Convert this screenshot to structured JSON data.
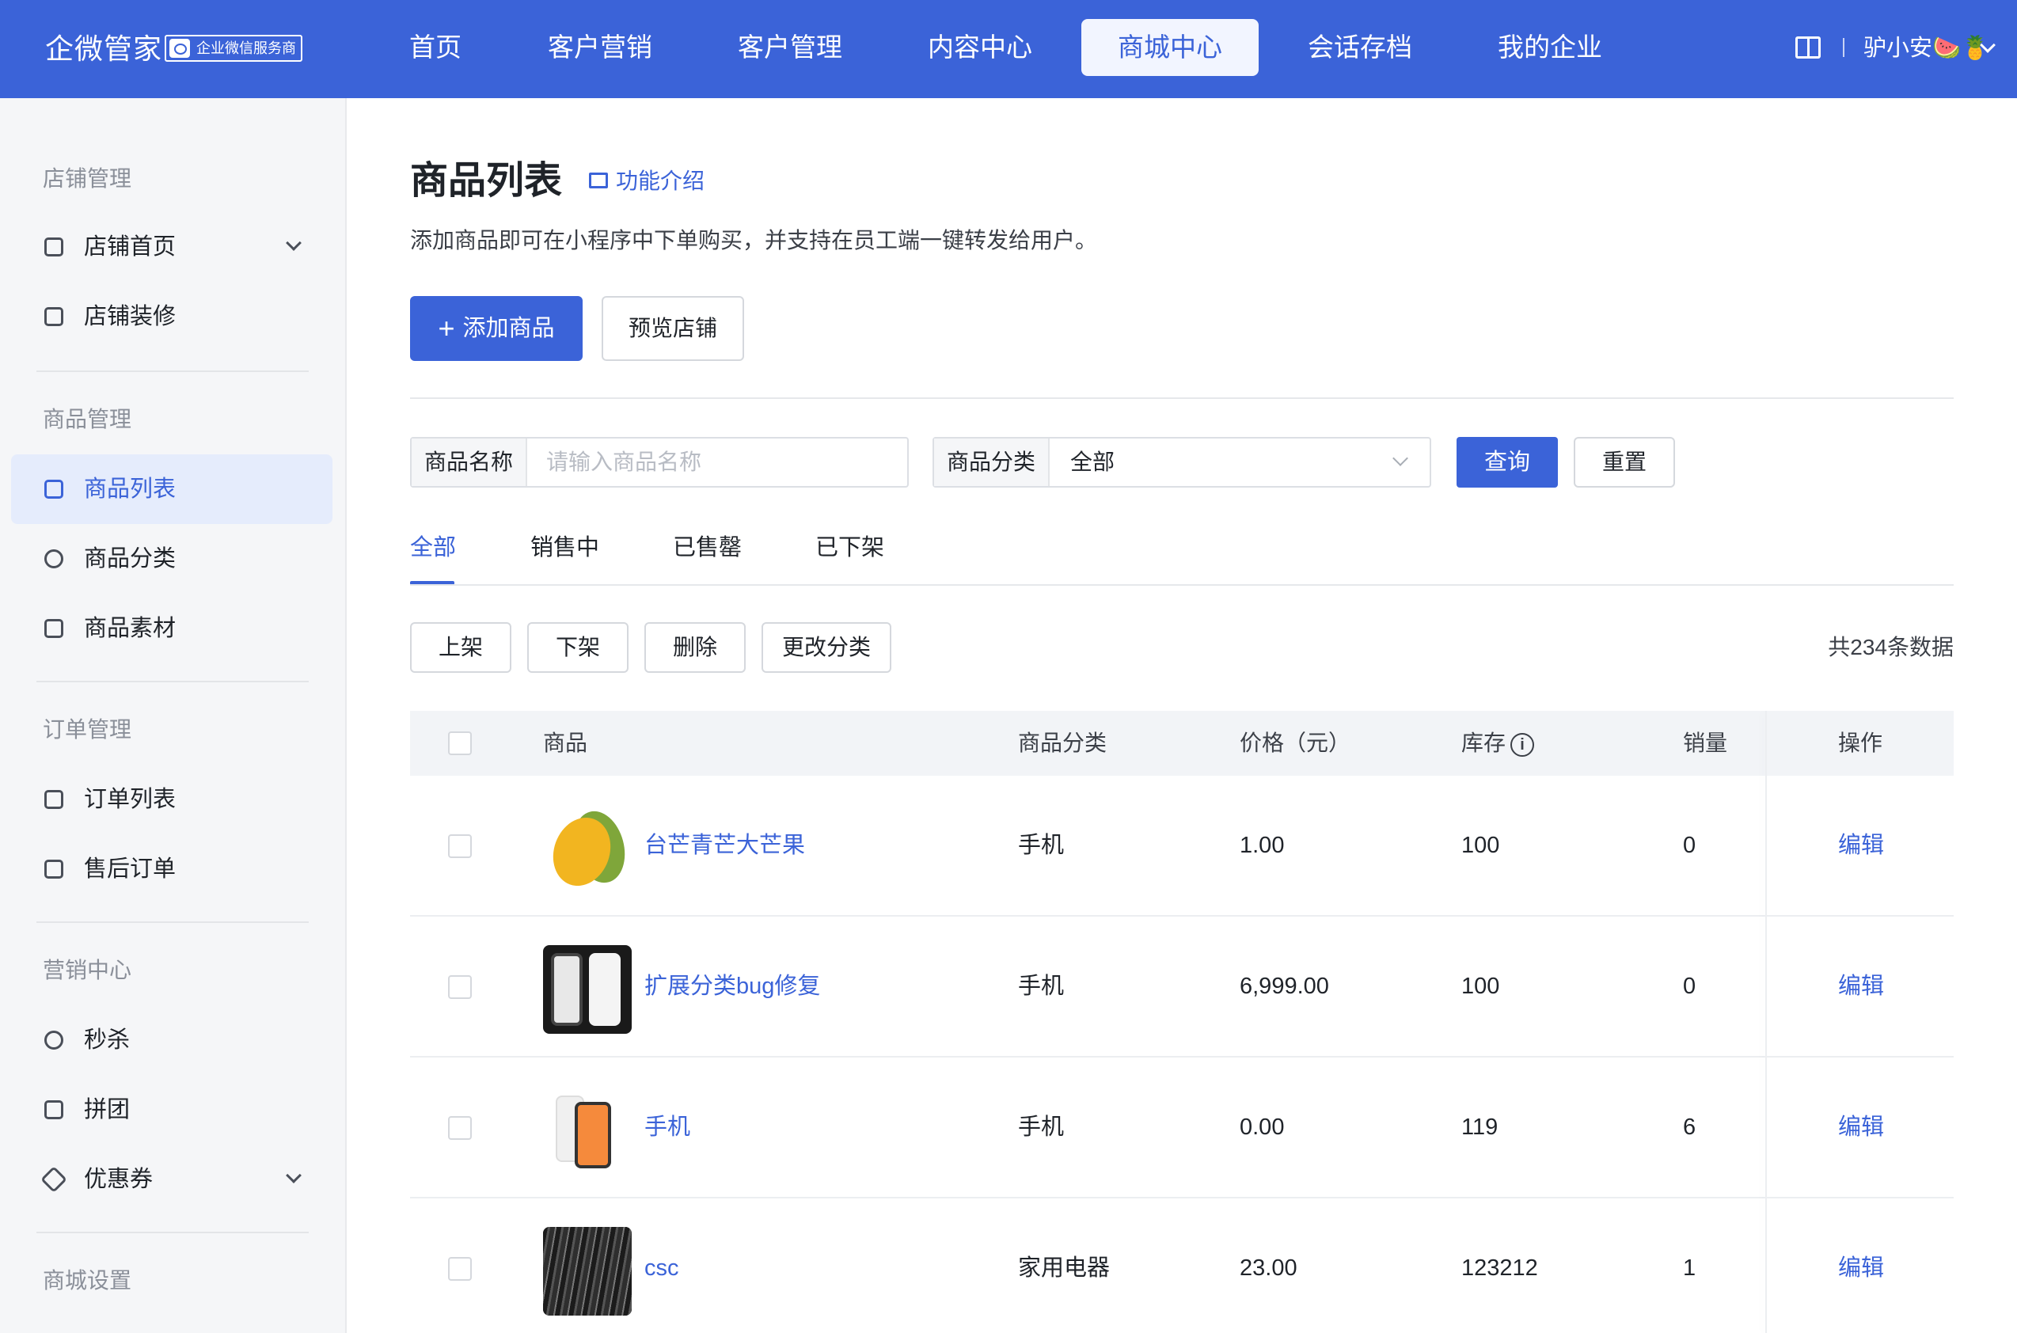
{
  "header": {
    "brand": "企微管家",
    "badge": "企业微信服务商",
    "nav": [
      {
        "label": "首页"
      },
      {
        "label": "客户营销"
      },
      {
        "label": "客户管理"
      },
      {
        "label": "内容中心"
      },
      {
        "label": "商城中心",
        "active": true
      },
      {
        "label": "会话存档"
      },
      {
        "label": "我的企业"
      }
    ],
    "user_name": "驴小安🍉🍍"
  },
  "sidebar": {
    "groups": [
      {
        "title": "店铺管理",
        "items": [
          {
            "label": "店铺首页",
            "icon": "store-icon",
            "expandable": true
          },
          {
            "label": "店铺装修",
            "icon": "decorate-icon"
          }
        ]
      },
      {
        "title": "商品管理",
        "items": [
          {
            "label": "商品列表",
            "icon": "list-icon",
            "active": true
          },
          {
            "label": "商品分类",
            "icon": "category-icon"
          },
          {
            "label": "商品素材",
            "icon": "material-icon"
          }
        ]
      },
      {
        "title": "订单管理",
        "items": [
          {
            "label": "订单列表",
            "icon": "clipboard-icon"
          },
          {
            "label": "售后订单",
            "icon": "after-sale-icon"
          }
        ]
      },
      {
        "title": "营销中心",
        "items": [
          {
            "label": "秒杀",
            "icon": "flash-icon"
          },
          {
            "label": "拼团",
            "icon": "group-buy-icon"
          },
          {
            "label": "优惠券",
            "icon": "coupon-icon",
            "expandable": true
          }
        ]
      },
      {
        "title": "商城设置",
        "items": []
      }
    ]
  },
  "page": {
    "title": "商品列表",
    "intro_link": "功能介绍",
    "description": "添加商品即可在小程序中下单购买，并支持在员工端一键转发给用户。",
    "add_button": "添加商品",
    "preview_button": "预览店铺"
  },
  "filters": {
    "name_label": "商品名称",
    "name_placeholder": "请输入商品名称",
    "category_label": "商品分类",
    "category_value": "全部",
    "query_button": "查询",
    "reset_button": "重置"
  },
  "tabs": [
    {
      "label": "全部",
      "active": true
    },
    {
      "label": "销售中"
    },
    {
      "label": "已售罄"
    },
    {
      "label": "已下架"
    }
  ],
  "bulk_actions": [
    "上架",
    "下架",
    "删除",
    "更改分类"
  ],
  "total_text": "共234条数据",
  "table": {
    "columns": [
      "商品",
      "商品分类",
      "价格（元）",
      "库存",
      "销量",
      "操作"
    ],
    "rows": [
      {
        "name": "台芒青芒大芒果",
        "category": "手机",
        "price": "1.00",
        "stock": "100",
        "sales": "0",
        "action": "编辑",
        "thumb": "mango"
      },
      {
        "name": "扩展分类bug修复",
        "category": "手机",
        "price": "6,999.00",
        "stock": "100",
        "sales": "0",
        "action": "编辑",
        "thumb": "phone"
      },
      {
        "name": "手机",
        "category": "手机",
        "price": "0.00",
        "stock": "119",
        "sales": "6",
        "action": "编辑",
        "thumb": "iphone"
      },
      {
        "name": "csc",
        "category": "家用电器",
        "price": "23.00",
        "stock": "123212",
        "sales": "1",
        "action": "编辑",
        "thumb": "bark"
      }
    ]
  },
  "colors": {
    "primary": "#3b63d8",
    "sidebar_active_bg": "#e5ecfc",
    "header_bg": "#3b63d8"
  }
}
